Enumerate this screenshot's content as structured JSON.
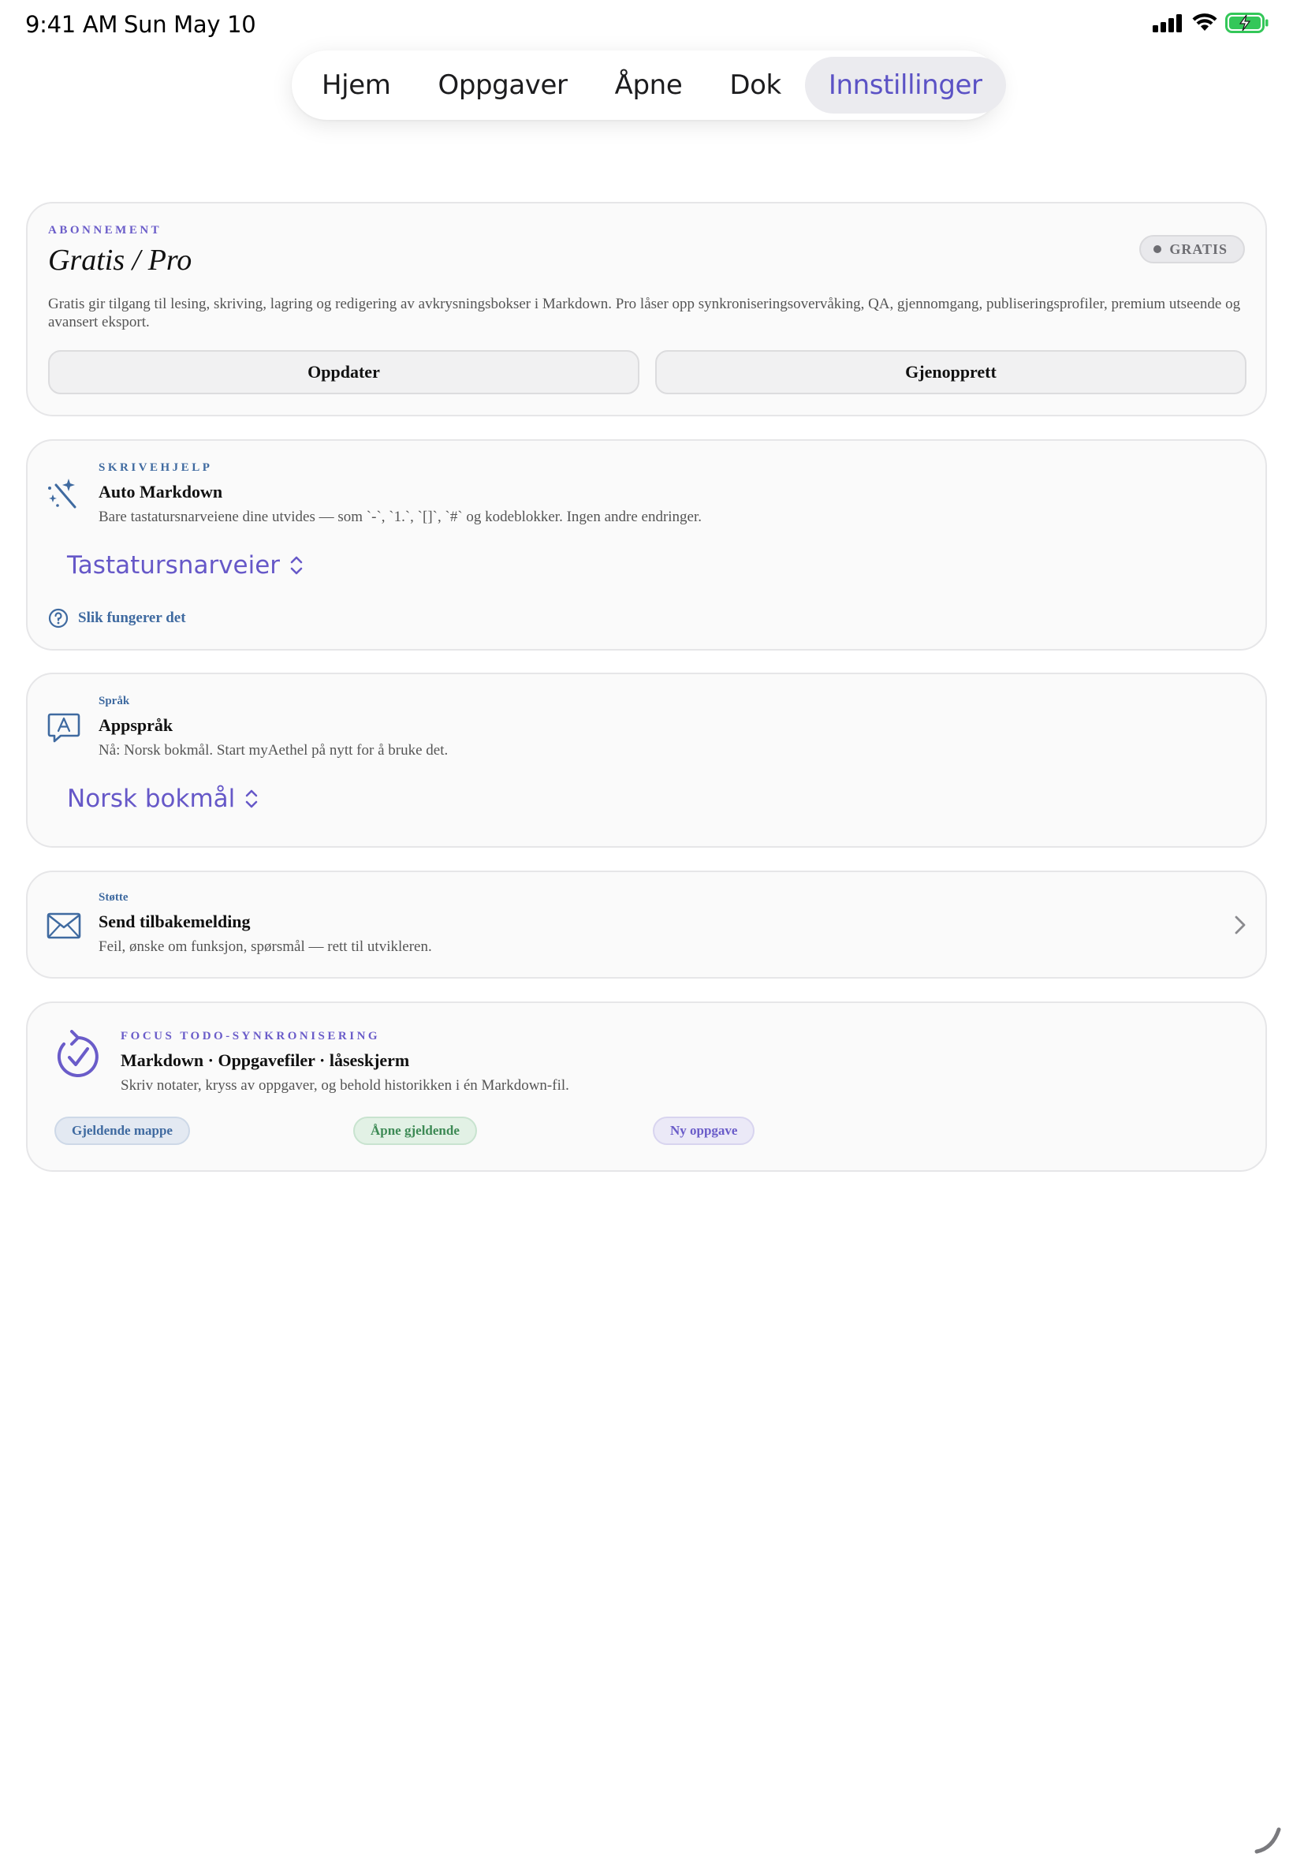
{
  "status_bar": {
    "time": "9:41 AM",
    "date": "Sun May 10"
  },
  "tabs": [
    {
      "label": "Hjem",
      "active": false
    },
    {
      "label": "Oppgaver",
      "active": false
    },
    {
      "label": "Åpne",
      "active": false
    },
    {
      "label": "Dok",
      "active": false
    },
    {
      "label": "Innstillinger",
      "active": true
    }
  ],
  "subscription": {
    "eyebrow": "ABONNEMENT",
    "title": "Gratis / Pro",
    "badge": "GRATIS",
    "description": "Gratis gir tilgang til lesing, skriving, lagring og redigering av avkrysningsbokser i Markdown. Pro låser opp synkroniseringsovervåking, QA, gjennomgang, publiseringsprofiler, premium utseende og avansert eksport.",
    "upgrade_label": "Oppdater",
    "restore_label": "Gjenopprett"
  },
  "writing_help": {
    "eyebrow": "SKRIVEHJELP",
    "title": "Auto Markdown",
    "description": "Bare tastatursnarveiene dine utvides — som `-`, `1.`, `[]`, `#` og kodeblokker. Ingen andre endringer.",
    "picker_value": "Tastatursnarveier",
    "help_link": "Slik fungerer det"
  },
  "language": {
    "eyebrow": "Språk",
    "title": "Appspråk",
    "description": "Nå: Norsk bokmål. Start myAethel på nytt for å bruke det.",
    "picker_value": "Norsk bokmål"
  },
  "support": {
    "eyebrow": "Støtte",
    "title": "Send tilbakemelding",
    "description": "Feil, ønske om funksjon, spørsmål — rett til utvikleren."
  },
  "sync": {
    "eyebrow": "FOCUS TODO-SYNKRONISERING",
    "title": "Markdown · Oppgavefiler · låseskjerm",
    "description": "Skriv notater, kryss av oppgaver, og behold historikken i én Markdown-fil.",
    "chips": [
      {
        "label": "Gjeldende mappe",
        "color": "#3f6aa0"
      },
      {
        "label": "Åpne gjeldende",
        "color": "#3d8a55"
      },
      {
        "label": "Ny oppgave",
        "color": "#6a5cc9"
      }
    ]
  },
  "colors": {
    "accent": "#5b52c5",
    "battery": "#34c759"
  }
}
